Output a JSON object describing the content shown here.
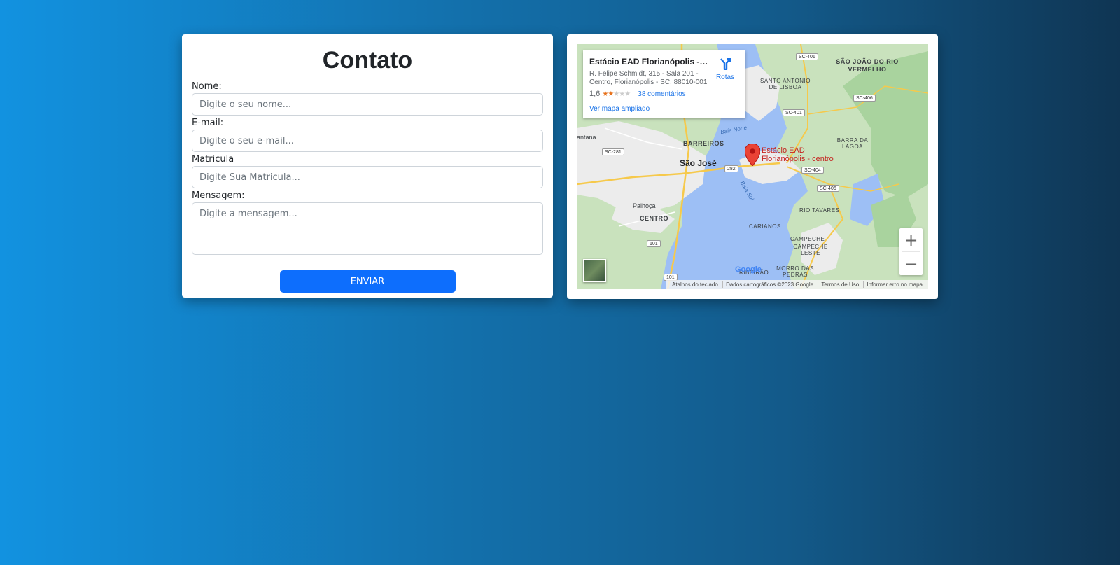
{
  "form": {
    "title": "Contato",
    "fields": [
      {
        "label": "Nome:",
        "placeholder": "Digite o seu nome..."
      },
      {
        "label": "E-mail:",
        "placeholder": "Digite o seu e-mail..."
      },
      {
        "label": "Matricula",
        "placeholder": "Digite Sua Matricula..."
      },
      {
        "label": "Mensagem:",
        "placeholder": "Digite a mensagem..."
      }
    ],
    "submit_label": "ENVIAR",
    "accent_color": "#0d6efd"
  },
  "map": {
    "place": {
      "title": "Estácio EAD Florianópolis - ce...",
      "address": "R. Felipe Schmidt, 315 - Sala 201 - Centro, Florianópolis - SC, 88010-001",
      "rating": "1,6",
      "stars_value": 1.6,
      "reviews_label": "38 comentários",
      "larger_map_label": "Ver mapa ampliado",
      "directions_label": "Rotas",
      "directions_icon": "directions-icon"
    },
    "zoom_in_label": "+",
    "zoom_out_label": "−",
    "labels": {
      "sao_jose": "São José",
      "barreiros": "BARREIROS",
      "palhoca": "Palhoça",
      "centro": "CENTRO",
      "santo_antonio": "SANTO ANTONIO DE LISBOA",
      "sao_joao": "SÃO JOÃO DO RIO VERMELHO",
      "barra_lagoa": "BARRA DA LAGOA",
      "rio_tavares": "RIO TAVARES",
      "carianos": "CARIANOS",
      "campeche": "CAMPECHE",
      "campeche_leste": "CAMPECHE LESTE",
      "morro_pedras": "MORRO DAS PEDRAS",
      "ribeirao": "RIBEIRÃO",
      "antana": "antana",
      "baia_norte": "Baía Norte",
      "baia_sul": "Baía Sul",
      "pin_place": "Estácio EAD Florianópolis - centro"
    },
    "roads": [
      "SC-401",
      "SC-401",
      "SC-406",
      "SC-281",
      "282",
      "SC-404",
      "SC-406",
      "101",
      "101"
    ],
    "google": "Google",
    "attribution": [
      "Atalhos do teclado",
      "Dados cartográficos ©2023 Google",
      "Termos de Uso",
      "Informar erro no mapa"
    ]
  }
}
